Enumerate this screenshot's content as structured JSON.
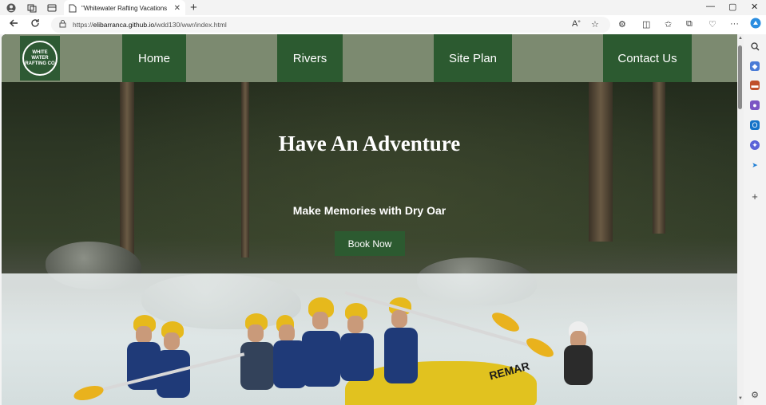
{
  "browser": {
    "tab_title": "\"Whitewater Rafting Vacations | ",
    "tab_close": "✕",
    "new_tab": "+",
    "url_protocol": "https://",
    "url_host": "elibarranca.github.io",
    "url_path": "/wdd130/wwr/index.html",
    "window_controls": [
      "—",
      "▢",
      "✕"
    ]
  },
  "logo": {
    "text": "WHITE WATER RAFTING CO"
  },
  "nav": {
    "items": [
      {
        "label": "Home"
      },
      {
        "label": "Rivers"
      },
      {
        "label": "Site Plan"
      },
      {
        "label": "Contact Us"
      }
    ]
  },
  "hero": {
    "title": "Have An Adventure",
    "subtitle": "Make Memories with Dry Oar",
    "button": "Book Now",
    "raft_label": "REMAR"
  },
  "colors": {
    "nav_bg": "#7c8a70",
    "accent_green": "#2c5a30",
    "white": "#ffffff"
  },
  "icons": {
    "profile": "profile-icon",
    "workspaces": "workspaces-icon",
    "tab_actions": "tab-actions-icon",
    "back": "back-arrow-icon",
    "refresh": "refresh-icon",
    "lock": "lock-icon",
    "read_aloud": "read-aloud-icon",
    "favorite": "star-icon",
    "extensions": "extensions-icon",
    "split": "split-screen-icon",
    "favorites_bar": "favorites-icon",
    "collections": "collections-icon",
    "browser_essentials": "heart-pulse-icon",
    "more": "more-icon",
    "copilot": "copilot-icon"
  }
}
